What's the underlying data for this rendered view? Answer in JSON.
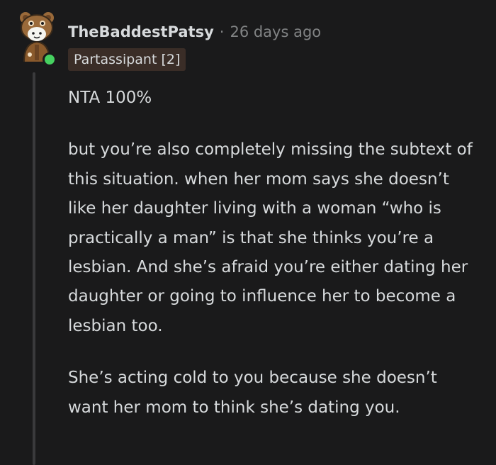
{
  "comment": {
    "author": "TheBaddestPatsy",
    "separator": "·",
    "time": "26 days ago",
    "flair": "Partassipant [2]",
    "paragraphs": [
      "NTA 100%",
      "but you’re also completely missing the subtext of this situation. when her mom says she doesn’t like her daughter living with a woman “who is practically a man” is that she thinks you’re a lesbian. And she’s afraid you’re either dating her daughter or going to influence her to become a lesbian too.",
      "She’s acting cold to you because she doesn’t want her mom to think she’s dating you."
    ]
  },
  "colors": {
    "background": "#1a1a1b",
    "text": "#d7dadc",
    "muted": "#818384",
    "flair_bg": "#3a2d27",
    "online": "#46d160",
    "thread_line": "#3a3a3c"
  },
  "icons": {
    "avatar": "bear-avatar-icon",
    "online": "online-status-icon"
  }
}
